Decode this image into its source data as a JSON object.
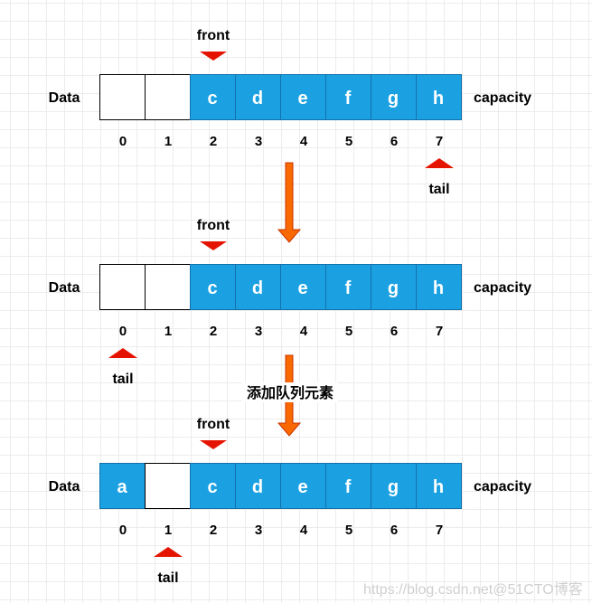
{
  "colors": {
    "filled_cell": "#1ba1e2",
    "filled_border": "#1371ac",
    "pointer": "#e51400",
    "flow_arrow": "#fa6800"
  },
  "rows": [
    {
      "row_label": "Data",
      "capacity_label": "capacity",
      "cells": [
        "",
        "",
        "c",
        "d",
        "e",
        "f",
        "g",
        "h"
      ],
      "indices": [
        "0",
        "1",
        "2",
        "3",
        "4",
        "5",
        "6",
        "7"
      ],
      "front": {
        "label": "front",
        "index": 2
      },
      "tail": {
        "label": "tail",
        "index": 7
      }
    },
    {
      "row_label": "Data",
      "capacity_label": "capacity",
      "cells": [
        "",
        "",
        "c",
        "d",
        "e",
        "f",
        "g",
        "h"
      ],
      "indices": [
        "0",
        "1",
        "2",
        "3",
        "4",
        "5",
        "6",
        "7"
      ],
      "front": {
        "label": "front",
        "index": 2
      },
      "tail": {
        "label": "tail",
        "index": 0
      }
    },
    {
      "row_label": "Data",
      "capacity_label": "capacity",
      "cells": [
        "a",
        "",
        "c",
        "d",
        "e",
        "f",
        "g",
        "h"
      ],
      "indices": [
        "0",
        "1",
        "2",
        "3",
        "4",
        "5",
        "6",
        "7"
      ],
      "front": {
        "label": "front",
        "index": 2
      },
      "tail": {
        "label": "tail",
        "index": 1
      }
    }
  ],
  "transition_label": "添加队列元素",
  "watermark": "https://blog.csdn.net@51CTO博客"
}
